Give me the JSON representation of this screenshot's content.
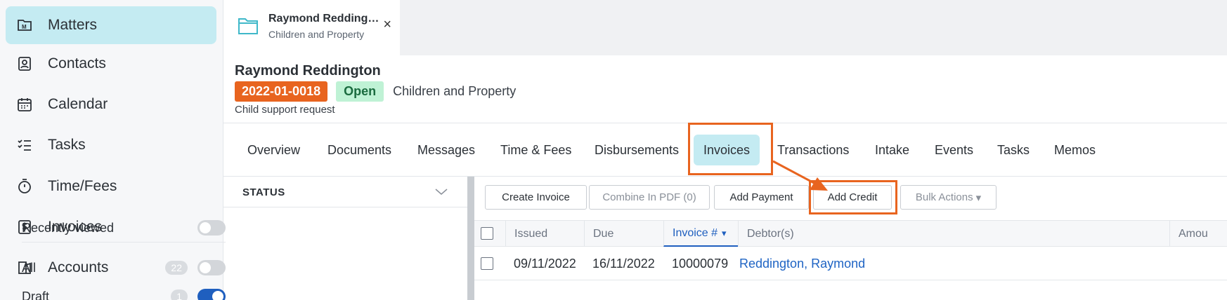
{
  "sidebar": {
    "items": [
      {
        "label": "Matters",
        "icon": "matters-icon",
        "active": true
      },
      {
        "label": "Contacts",
        "icon": "contacts-icon"
      },
      {
        "label": "Calendar",
        "icon": "calendar-icon"
      },
      {
        "label": "Tasks",
        "icon": "tasks-icon"
      },
      {
        "label": "Time/Fees",
        "icon": "stopwatch-icon"
      },
      {
        "label": "Invoices",
        "icon": "dollar-icon"
      },
      {
        "label": "Accounts",
        "icon": "accounts-icon"
      }
    ]
  },
  "open_tab": {
    "title": "Raymond Reddingt…",
    "subtitle": "Children and Property",
    "close_label": "×",
    "icon": "folder-icon"
  },
  "matter": {
    "name": "Raymond Reddington",
    "number": "2022-01-0018",
    "status": "Open",
    "type": "Children and Property",
    "description": "Child support request",
    "colors": {
      "number_badge": "#e8641f",
      "status_badge": "#bff2d5",
      "accent": "#c4ebf2"
    }
  },
  "section_tabs": [
    {
      "label": "Overview"
    },
    {
      "label": "Documents"
    },
    {
      "label": "Messages"
    },
    {
      "label": "Time & Fees"
    },
    {
      "label": "Disbursements"
    },
    {
      "label": "Invoices",
      "active": true
    },
    {
      "label": "Transactions"
    },
    {
      "label": "Intake"
    },
    {
      "label": "Events"
    },
    {
      "label": "Tasks"
    },
    {
      "label": "Memos"
    }
  ],
  "filter": {
    "title": "STATUS",
    "rows": [
      {
        "label": "Recently viewed",
        "count": "",
        "on": false
      },
      {
        "label": "All",
        "count": "22",
        "on": false
      },
      {
        "label": "Draft",
        "count": "1",
        "on": true
      }
    ]
  },
  "toolbar": {
    "create_invoice": "Create Invoice",
    "combine_pdf": "Combine In PDF (0)",
    "add_payment": "Add Payment",
    "add_credit": "Add Credit",
    "bulk_actions": "Bulk Actions",
    "bulk_caret": "▾"
  },
  "table": {
    "columns": [
      "Issued",
      "Due",
      "Invoice #",
      "Debtor(s)",
      "Amou"
    ],
    "sort_caret": "▾",
    "rows": [
      {
        "issued": "09/11/2022",
        "due": "16/11/2022",
        "invoice_no": "10000079",
        "debtor": "Reddington, Raymond"
      }
    ]
  },
  "annotation": {
    "highlight_color": "#e8641f"
  }
}
